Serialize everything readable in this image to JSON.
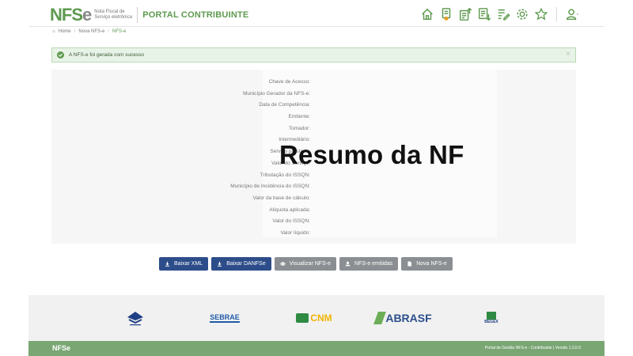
{
  "header": {
    "logo_nf": "NF",
    "logo_s": "S",
    "logo_e": "e",
    "logo_sub": "Nota Fiscal de Serviço eletrônica",
    "portal": "PORTAL CONTRIBUINTE"
  },
  "breadcrumb": [
    "Home",
    "Nova NFS-e",
    "NFS-e"
  ],
  "alert": {
    "message": "A NFS-e foi gerada com sucesso",
    "close": "×"
  },
  "summary": {
    "labels": [
      "Chave de Acesso:",
      "Município Gerador da NFS-e:",
      "Data de Competência:",
      "Emitente:",
      "Tomador:",
      "Intermediário:",
      "Serviço prestado:",
      "Valor do Serviço:",
      "Tributação do ISSQN:",
      "Município de Incidência do ISSQN:",
      "Valor da base de cálculo:",
      "Alíquota aplicada:",
      "Valor do ISSQN:",
      "Valor líquido:"
    ],
    "overlay": "Resumo da NF"
  },
  "buttons": {
    "baixar_xml": "Baixar XML",
    "baixar_danfse": "Baixar DANFSe",
    "visualizar": "Visualizar NFS-e",
    "emitidas": "NFS-e emitidas",
    "nova": "Nova NFS-e"
  },
  "footer": {
    "partners": [
      "SEBRAE",
      "CNM",
      "ABRASF",
      "BEGEX"
    ],
    "bottom_logo": "NFS",
    "bottom_logo_e": "e",
    "version": "Portal de Gestão NFS-e - Contribuinte | Versão 1.3.0.0"
  },
  "colors": {
    "brand_green": "#5e9a4f",
    "primary_button": "#2d4d8a",
    "secondary_button": "#8b8f93"
  }
}
